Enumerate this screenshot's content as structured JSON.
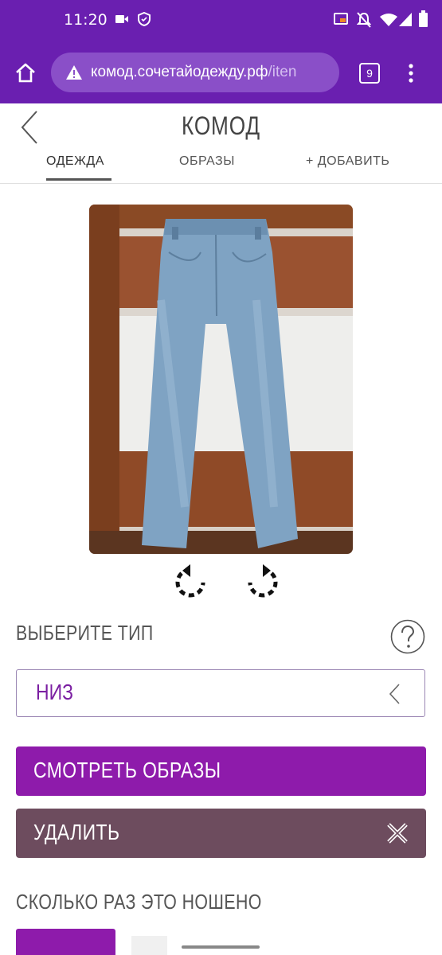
{
  "status_bar": {
    "time": "11:20",
    "icons": [
      "video-icon",
      "shield-check-icon",
      "cast-icon",
      "mute-icon",
      "wifi-icon",
      "signal-icon",
      "battery-icon"
    ]
  },
  "browser": {
    "url_host": "комод.сочетайодежду.рф",
    "url_path": "/iten",
    "tab_count": "9",
    "icons": [
      "home-icon",
      "warning-icon",
      "menu-dots-icon"
    ]
  },
  "header": {
    "title": "КОМОД",
    "tabs": [
      {
        "label": "ОДЕЖДА",
        "active": true
      },
      {
        "label": "ОБРАЗЫ",
        "active": false
      },
      {
        "label": "+ ДОБАВИТЬ",
        "active": false
      }
    ]
  },
  "item": {
    "type_label": "ВЫБЕРИТЕ ТИП",
    "type_value": "НИЗ",
    "view_outfits_label": "СМОТРЕТЬ ОБРАЗЫ",
    "delete_label": "УДАЛИТЬ",
    "worn_label": "СКОЛЬКО РАЗ ЭТО НОШЕНО"
  },
  "colors": {
    "status_bar": "#6a1fb0",
    "accent": "#8e1bab",
    "delete": "#6d4c5e",
    "select_text": "#7b1fa2"
  }
}
